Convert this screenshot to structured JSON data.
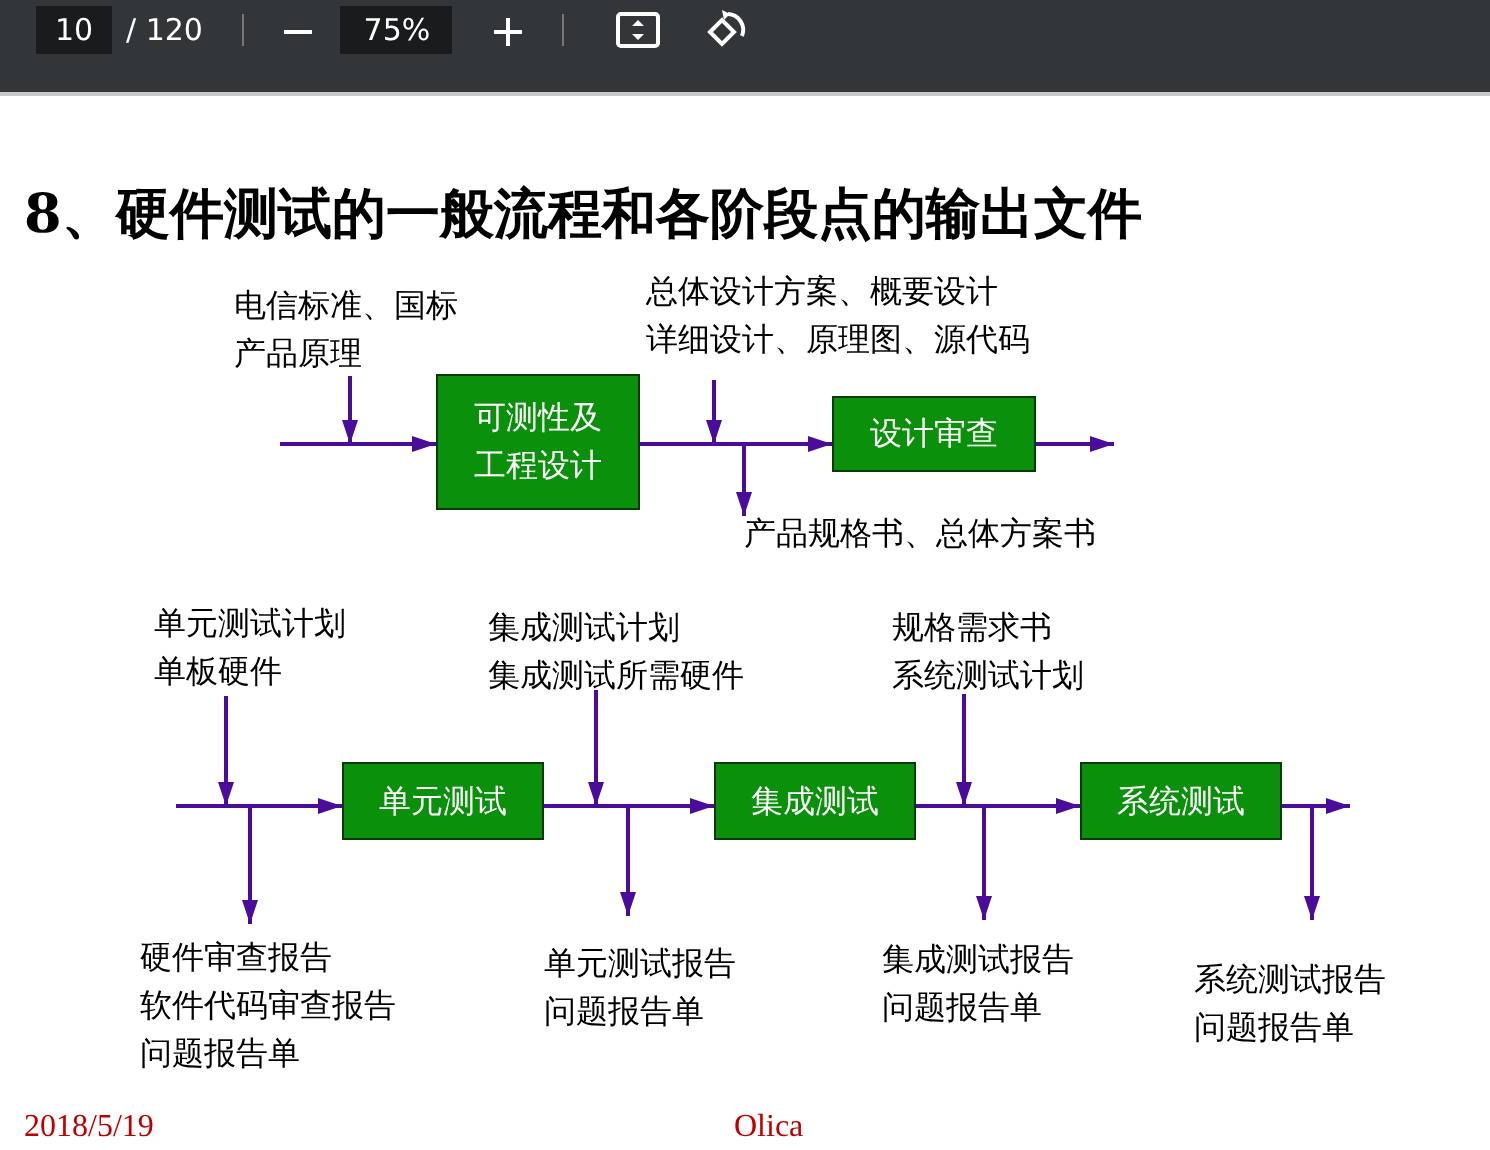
{
  "toolbar": {
    "page": "10",
    "page_total": "/ 120",
    "zoom": "75%"
  },
  "slide": {
    "title": "8、硬件测试的一般流程和各阶段点的输出文件",
    "flows": [
      {
        "boxes": [
          {
            "lines": [
              "可测性及",
              "工程设计"
            ]
          },
          {
            "lines": [
              "设计审查"
            ]
          }
        ],
        "inputs": [
          {
            "lines": [
              "电信标准、国标",
              "产品原理"
            ]
          },
          {
            "lines": [
              "总体设计方案、概要设计",
              "详细设计、原理图、源代码"
            ]
          }
        ],
        "outputs": [
          {
            "lines": [
              "产品规格书、总体方案书"
            ]
          }
        ]
      },
      {
        "boxes": [
          {
            "lines": [
              "单元测试"
            ]
          },
          {
            "lines": [
              "集成测试"
            ]
          },
          {
            "lines": [
              "系统测试"
            ]
          }
        ],
        "inputs": [
          {
            "lines": [
              "单元测试计划",
              "单板硬件"
            ]
          },
          {
            "lines": [
              "集成测试计划",
              "集成测试所需硬件"
            ]
          },
          {
            "lines": [
              "规格需求书",
              "系统测试计划"
            ]
          }
        ],
        "outputs": [
          {
            "lines": [
              "硬件审查报告",
              "软件代码审查报告",
              "问题报告单"
            ]
          },
          {
            "lines": [
              "单元测试报告",
              "问题报告单"
            ]
          },
          {
            "lines": [
              "集成测试报告",
              "问题报告单"
            ]
          },
          {
            "lines": [
              "系统测试报告",
              "问题报告单"
            ]
          }
        ]
      }
    ],
    "date": "2018/5/19",
    "author": "Olica"
  }
}
